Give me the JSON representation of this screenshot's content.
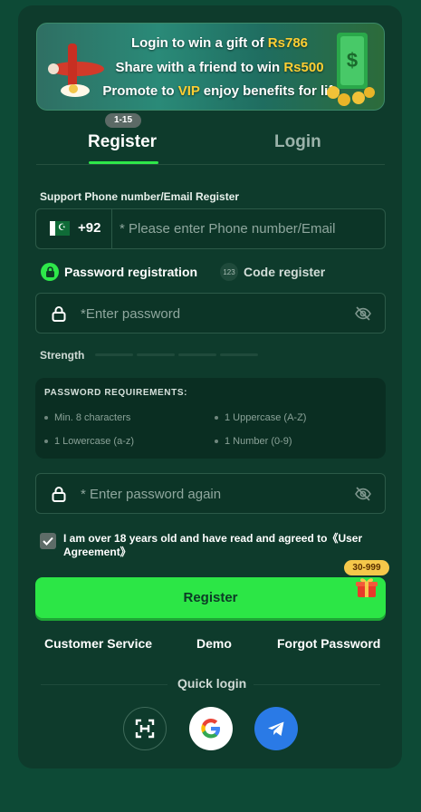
{
  "banner": {
    "line1_text": "Login to win a gift of ",
    "line1_amount": "Rs786",
    "line2_text": "Share with a friend to win ",
    "line2_amount": "Rs500",
    "line3_pre": "Promote to ",
    "line3_vip": "VIP",
    "line3_post": " enjoy benefits for life"
  },
  "age_badge": "1-15",
  "tabs": {
    "register": "Register",
    "login": "Login",
    "active": "register"
  },
  "form": {
    "support_label": "Support Phone number/Email Register",
    "country_code": "+92",
    "phone_placeholder": "* Please enter Phone number/Email",
    "mode_password": "Password registration",
    "mode_code_icon": "123",
    "mode_code": "Code register",
    "password_placeholder": "*Enter password",
    "strength_label": "Strength",
    "requirements_title": "PASSWORD REQUIREMENTS:",
    "requirements": [
      "Min. 8 characters",
      "1 Uppercase (A-Z)",
      "1 Lowercase (a-z)",
      "1 Number (0-9)"
    ],
    "password_again_placeholder": "* Enter password again",
    "agreement": "I am over 18 years old and have read and agreed to《User Agreement》",
    "agreement_checked": true,
    "register_button": "Register",
    "gift_badge": "30-999"
  },
  "links": {
    "customer_service": "Customer Service",
    "demo": "Demo",
    "forgot_password": "Forgot Password"
  },
  "quick_login": {
    "label": "Quick login",
    "options": [
      "scan-icon",
      "google-icon",
      "telegram-icon"
    ]
  },
  "colors": {
    "accent": "#2ce646",
    "background": "#0d4a36",
    "card": "#0e3b2c",
    "badge": "#f5c84a"
  }
}
